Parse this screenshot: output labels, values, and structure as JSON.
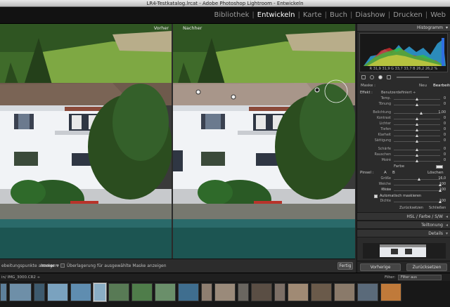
{
  "window": {
    "title": "LR4-Testkatalog.lrcat - Adobe Photoshop Lightroom - Entwickeln"
  },
  "modules": [
    {
      "label": "Bibliothek",
      "active": false
    },
    {
      "label": "Entwickeln",
      "active": true
    },
    {
      "label": "Karte",
      "active": false
    },
    {
      "label": "Buch",
      "active": false
    },
    {
      "label": "Diashow",
      "active": false
    },
    {
      "label": "Drucken",
      "active": false
    },
    {
      "label": "Web",
      "active": false
    }
  ],
  "viewer": {
    "before_label": "Vorher",
    "after_label": "Nachher"
  },
  "toolbar": {
    "overlay_label": "ebeitungspunkte anzeigen:",
    "overlay_value": "Immer ÷",
    "mask_overlay_label": "Überlagerung für ausgewählte Maske anzeigen",
    "done_label": "Fertig"
  },
  "histogram": {
    "title": "Histogramm",
    "readout": "R 31,9 31,9  G 33,7 33,7  B 26,2 26,2 %"
  },
  "mask": {
    "label": "Maske :",
    "new_label": "Neu",
    "edit_label": "Bearbeiten"
  },
  "effect": {
    "label": "Effekt :",
    "value": "Benutzerdefiniert ÷"
  },
  "sliders_a": [
    {
      "label": "Temp.",
      "value": "0"
    },
    {
      "label": "Tönung",
      "value": "0"
    }
  ],
  "sliders_b": [
    {
      "label": "Belichtung",
      "value": "1,00"
    },
    {
      "label": "Kontrast",
      "value": "0"
    },
    {
      "label": "Lichter",
      "value": "0"
    },
    {
      "label": "Tiefen",
      "value": "0"
    },
    {
      "label": "Klarheit",
      "value": "0"
    },
    {
      "label": "Sättigung",
      "value": "0"
    }
  ],
  "sliders_c": [
    {
      "label": "Schärfe",
      "value": "0"
    },
    {
      "label": "Rauschen",
      "value": "0"
    },
    {
      "label": "Moiré",
      "value": "0"
    }
  ],
  "color": {
    "label": "Farbe"
  },
  "brush": {
    "label": "Pinsel :",
    "a": "A",
    "b": "B",
    "erase": "Löschen"
  },
  "sliders_d": [
    {
      "label": "Größe",
      "value": "16,0"
    },
    {
      "label": "Weiche Kante",
      "value": "100"
    },
    {
      "label": "Fluss",
      "value": "100"
    }
  ],
  "auto_mask": {
    "label": "Automatisch maskieren"
  },
  "density": {
    "label": "Dichte",
    "value": "100"
  },
  "panel_footer": {
    "reset": "Zurücksetzen",
    "close": "Schließen"
  },
  "collapsed_panels": [
    {
      "label": "HSL  /  Farbe  /  S/W"
    },
    {
      "label": "Teiltonung"
    },
    {
      "label": "Details"
    }
  ],
  "buttons": {
    "previous": "Vorherige",
    "reset": "Zurücksetzen"
  },
  "filmstrip": {
    "path": "in/ IMG_3000.CR2 ÷",
    "filter_label": "Filter:",
    "filter_value": "Filter aus"
  }
}
